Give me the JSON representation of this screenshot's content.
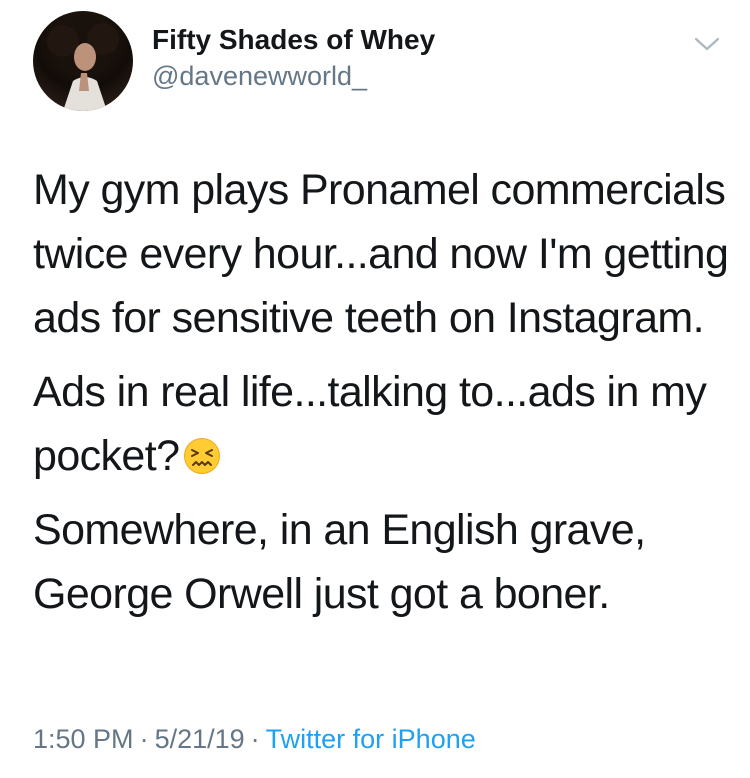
{
  "author": {
    "display_name": "Fifty Shades of Whey",
    "handle": "@davenewworld_"
  },
  "tweet": {
    "paragraphs": [
      "My gym plays Pronamel commercials twice every hour...and now I'm getting ads for sensitive teeth on Instagram.",
      "Ads in real life...talking to...ads in my pocket?",
      "Somewhere, in an English grave, George Orwell just got a boner."
    ],
    "emoji_icon": "confounded-face-emoji"
  },
  "meta": {
    "time": "1:50 PM",
    "date": "5/21/19",
    "separator": "·",
    "source": "Twitter for iPhone"
  },
  "colors": {
    "text": "#14171a",
    "secondary": "#657786",
    "link": "#1da1f2"
  }
}
